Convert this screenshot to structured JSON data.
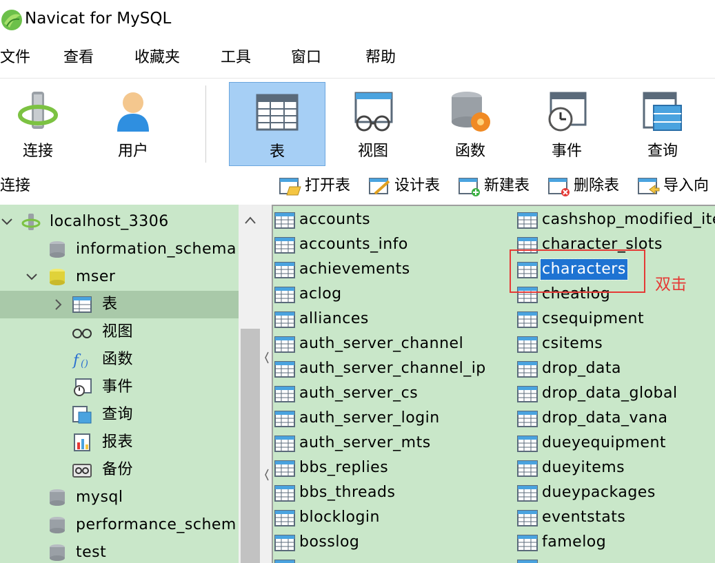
{
  "window": {
    "title": "Navicat for MySQL"
  },
  "menu": [
    "文件",
    "查看",
    "收藏夹",
    "工具",
    "窗口",
    "帮助"
  ],
  "toolbar": {
    "connect": "连接",
    "user": "用户",
    "table": "表",
    "view": "视图",
    "function": "函数",
    "event": "事件",
    "query": "查询"
  },
  "connection_pane": {
    "label": "连接"
  },
  "table_actions": {
    "open": "打开表",
    "design": "设计表",
    "new": "新建表",
    "delete": "删除表",
    "import": "导入向"
  },
  "tree": {
    "connection": "localhost_3306",
    "db_information_schema": "information_schema",
    "db_mser": "mser",
    "node_tables": "表",
    "node_views": "视图",
    "node_functions": "函数",
    "node_events": "事件",
    "node_queries": "查询",
    "node_reports": "报表",
    "node_backups": "备份",
    "db_mysql": "mysql",
    "db_performance_schema": "performance_schem",
    "db_test": "test"
  },
  "tables_col1": [
    "accounts",
    "accounts_info",
    "achievements",
    "aclog",
    "alliances",
    "auth_server_channel",
    "auth_server_channel_ip",
    "auth_server_cs",
    "auth_server_login",
    "auth_server_mts",
    "bbs_replies",
    "bbs_threads",
    "blocklogin",
    "bosslog"
  ],
  "tables_col2": [
    "cashshop_modified_ite",
    "character_slots",
    "characters",
    "cheatlog",
    "csequipment",
    "csitems",
    "drop_data",
    "drop_data_global",
    "drop_data_vana",
    "dueyequipment",
    "dueyitems",
    "dueypackages",
    "eventstats",
    "famelog"
  ],
  "selected_table": "characters",
  "annotation": {
    "text": "双击",
    "color": "#e53935"
  },
  "colors": {
    "panel_bg": "#c9e7c9",
    "selection": "#1e73d2",
    "toolbar_active": "#a6cff5"
  }
}
